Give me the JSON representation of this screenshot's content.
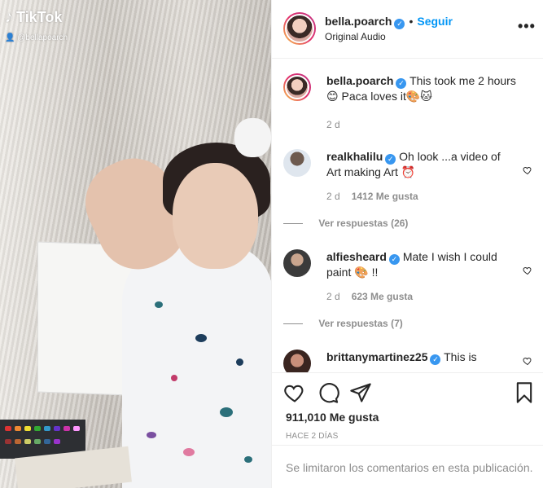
{
  "media": {
    "watermark_logo": "TikTok",
    "watermark_handle": "@bellapoarch"
  },
  "header": {
    "username": "bella.poarch",
    "separator": "•",
    "follow_label": "Seguir",
    "audio": "Original Audio",
    "more_label": "•••"
  },
  "caption": {
    "username": "bella.poarch",
    "text": "This took me 2 hours 😊 Paca loves it🎨🐱",
    "time": "2 d"
  },
  "comments": [
    {
      "username": "realkhalilu",
      "text": "Oh look ...a video of Art making Art ⏰",
      "time": "2 d",
      "likes": "1412 Me gusta",
      "replies": "Ver respuestas (26)"
    },
    {
      "username": "alfiesheard",
      "text": "Mate I wish I could paint 🎨 !!",
      "time": "2 d",
      "likes": "623 Me gusta",
      "replies": "Ver respuestas (7)"
    },
    {
      "username": "brittanymartinez25",
      "text": "This is"
    }
  ],
  "footer": {
    "likes": "911,010 Me gusta",
    "posted": "HACE 2 DÍAS",
    "comments_limited": "Se limitaron los comentarios en esta publicación."
  },
  "colors": {
    "accent": "#0095f6",
    "verified": "#3897f0",
    "muted": "#8e8e8e"
  }
}
